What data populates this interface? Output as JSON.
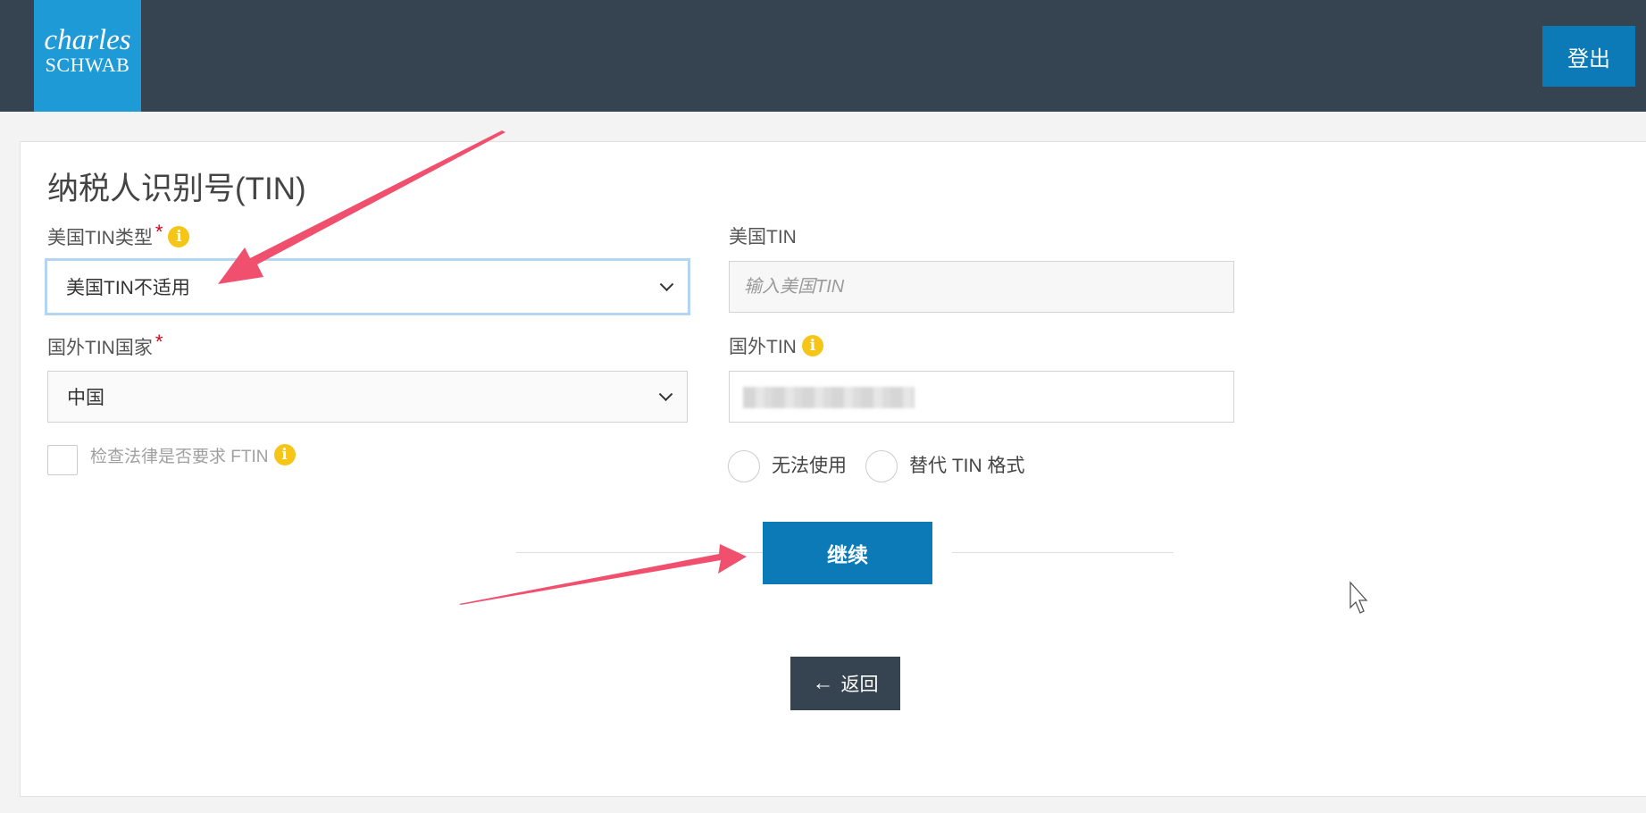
{
  "header": {
    "logo_line1": "charles",
    "logo_line2": "SCHWAB",
    "logout_label": "登出"
  },
  "form": {
    "title": "纳税人识别号(TIN)",
    "us_tin_type": {
      "label": "美国TIN类型",
      "required_mark": "*",
      "info_icon": "i",
      "selected": "美国TIN不适用"
    },
    "us_tin": {
      "label": "美国TIN",
      "placeholder": "输入美国TIN"
    },
    "foreign_country": {
      "label": "国外TIN国家",
      "required_mark": "*",
      "selected": "中国"
    },
    "foreign_tin": {
      "label": "国外TIN",
      "info_icon": "i",
      "value_note": "redacted"
    },
    "check_law": {
      "label": "检查法律是否要求 FTIN",
      "info_icon": "i"
    },
    "radio_options": [
      "无法使用",
      "替代 TIN 格式"
    ]
  },
  "actions": {
    "continue_label": "继续",
    "back_label": "返回",
    "back_icon": "←"
  },
  "colors": {
    "topbar": "#364350",
    "logo": "#1e9bd7",
    "primary_button": "#0b7ab6",
    "annotation_arrow": "#f0506e",
    "info_icon": "#f5c518"
  }
}
